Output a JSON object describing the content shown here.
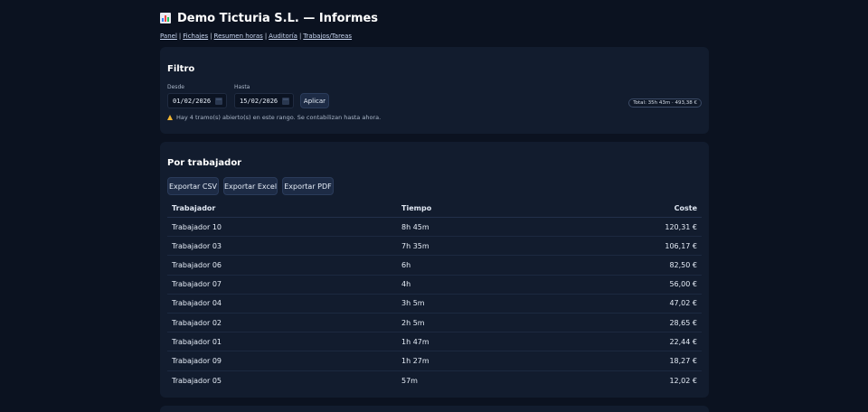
{
  "header": {
    "title": "Demo Ticturia S.L. — Informes",
    "icon": "bar-chart-icon"
  },
  "nav": {
    "items": [
      {
        "label": "Panel"
      },
      {
        "label": "Fichajes"
      },
      {
        "label": "Resumen horas"
      },
      {
        "label": "Auditoría"
      },
      {
        "label": "Trabajos/Tareas"
      }
    ],
    "separator": "|"
  },
  "filter": {
    "title": "Filtro",
    "from_label": "Desde",
    "from_value": "01/02/2026",
    "to_label": "Hasta",
    "to_value": "15/02/2026",
    "apply_label": "Aplicar",
    "total": "Total: 35h 43m · 493,38 €",
    "warning": "Hay 4 tramo(s) abierto(s) en este rango. Se contabilizan hasta ahora."
  },
  "workers": {
    "title": "Por trabajador",
    "export_csv": "Exportar CSV",
    "export_excel": "Exportar Excel",
    "export_pdf": "Exportar PDF",
    "columns": [
      "Trabajador",
      "Tiempo",
      "Coste"
    ],
    "rows": [
      {
        "name": "Trabajador 10",
        "time": "8h 45m",
        "cost": "120,31 €"
      },
      {
        "name": "Trabajador 03",
        "time": "7h 35m",
        "cost": "106,17 €"
      },
      {
        "name": "Trabajador 06",
        "time": "6h",
        "cost": "82,50 €"
      },
      {
        "name": "Trabajador 07",
        "time": "4h",
        "cost": "56,00 €"
      },
      {
        "name": "Trabajador 04",
        "time": "3h 5m",
        "cost": "47,02 €"
      },
      {
        "name": "Trabajador 02",
        "time": "2h 5m",
        "cost": "28,65 €"
      },
      {
        "name": "Trabajador 01",
        "time": "1h 47m",
        "cost": "22,44 €"
      },
      {
        "name": "Trabajador 09",
        "time": "1h 27m",
        "cost": "18,27 €"
      },
      {
        "name": "Trabajador 05",
        "time": "57m",
        "cost": "12,02 €"
      }
    ]
  },
  "colors": {
    "background": "#0b1220",
    "card": "#121c2e",
    "button": "#1d2b45",
    "warning_icon": "#f2b632"
  }
}
